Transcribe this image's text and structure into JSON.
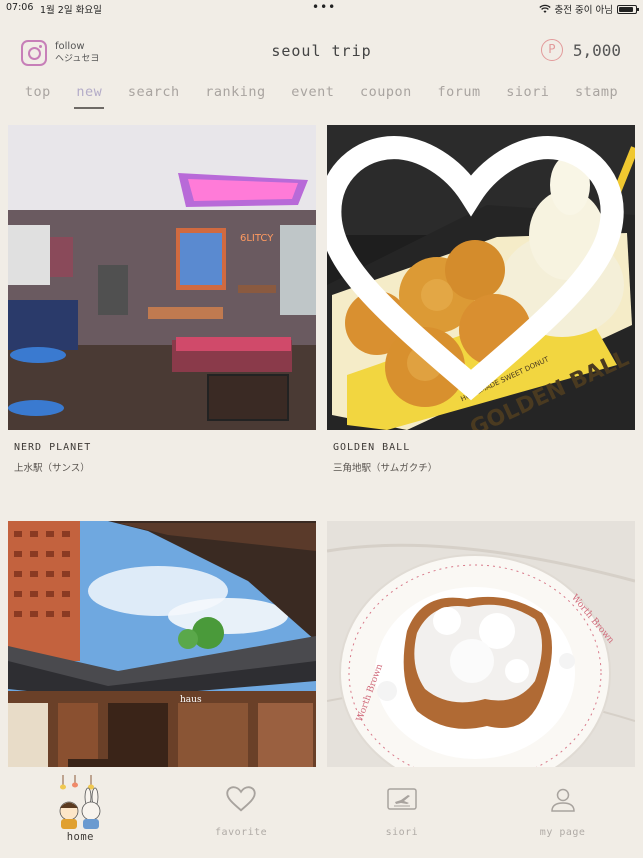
{
  "status_bar": {
    "time": "07:06",
    "date": "1월 2일 화요일",
    "dots": "•••",
    "network": "충전 중이 아님",
    "battery_percent": 90
  },
  "header": {
    "follow_label": "follow",
    "follow_sub": "ヘジュセヨ",
    "title": "seoul trip",
    "points_symbol": "P",
    "points_value": "5,000"
  },
  "tabs": [
    {
      "label": "top",
      "active": false
    },
    {
      "label": "new",
      "active": true
    },
    {
      "label": "search",
      "active": false
    },
    {
      "label": "ranking",
      "active": false
    },
    {
      "label": "event",
      "active": false
    },
    {
      "label": "coupon",
      "active": false
    },
    {
      "label": "forum",
      "active": false
    },
    {
      "label": "siori",
      "active": false
    },
    {
      "label": "stamp",
      "active": false
    }
  ],
  "cards": [
    {
      "name": "NERD PLANET",
      "station": "上水駅（サンス）",
      "image": "cafe-interior-neon"
    },
    {
      "name": "GOLDEN BALL",
      "station": "三角地駅（サムガクチ）",
      "image": "fried-balls-softserve",
      "box_text": "GOLDEN BALL",
      "box_sub": "HOMEMADE SWEET DONUT"
    },
    {
      "name": "",
      "station": "",
      "image": "hanok-building",
      "sign_text": "haus"
    },
    {
      "name": "",
      "station": "",
      "image": "sugar-pastry-plate",
      "plate_text": "Worth Brown"
    }
  ],
  "bottom_nav": [
    {
      "label": "home",
      "icon": "home-mascot-icon",
      "active": true
    },
    {
      "label": "favorite",
      "icon": "heart-icon",
      "active": false
    },
    {
      "label": "siori",
      "icon": "ticket-icon",
      "active": false
    },
    {
      "label": "my page",
      "icon": "person-icon",
      "active": false
    }
  ],
  "colors": {
    "background": "#f1ede6",
    "accent_tab": "#b4acc8",
    "points": "#e29a9a",
    "instagram": "#c77fb8"
  }
}
